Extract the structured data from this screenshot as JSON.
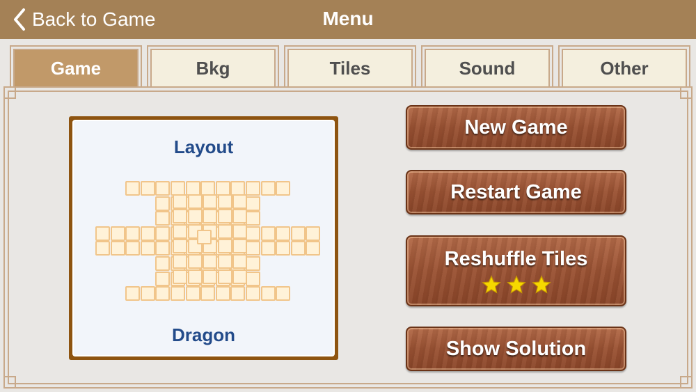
{
  "header": {
    "back_label": "Back to Game",
    "title": "Menu"
  },
  "tabs": [
    {
      "label": "Game",
      "active": true
    },
    {
      "label": "Bkg",
      "active": false
    },
    {
      "label": "Tiles",
      "active": false
    },
    {
      "label": "Sound",
      "active": false
    },
    {
      "label": "Other",
      "active": false
    }
  ],
  "layout_preview": {
    "heading": "Layout",
    "name": "Dragon"
  },
  "actions": {
    "new_game": "New Game",
    "restart_game": "Restart Game",
    "reshuffle_tiles": "Reshuffle Tiles",
    "reshuffle_stars": 3,
    "show_solution": "Show Solution"
  },
  "colors": {
    "header_bg": "#a48156",
    "tab_active": "#c19969",
    "tab_inactive": "#f4efde",
    "button_wood": "#9a5233",
    "label_blue": "#234b8a",
    "star_yellow": "#f6d800"
  }
}
